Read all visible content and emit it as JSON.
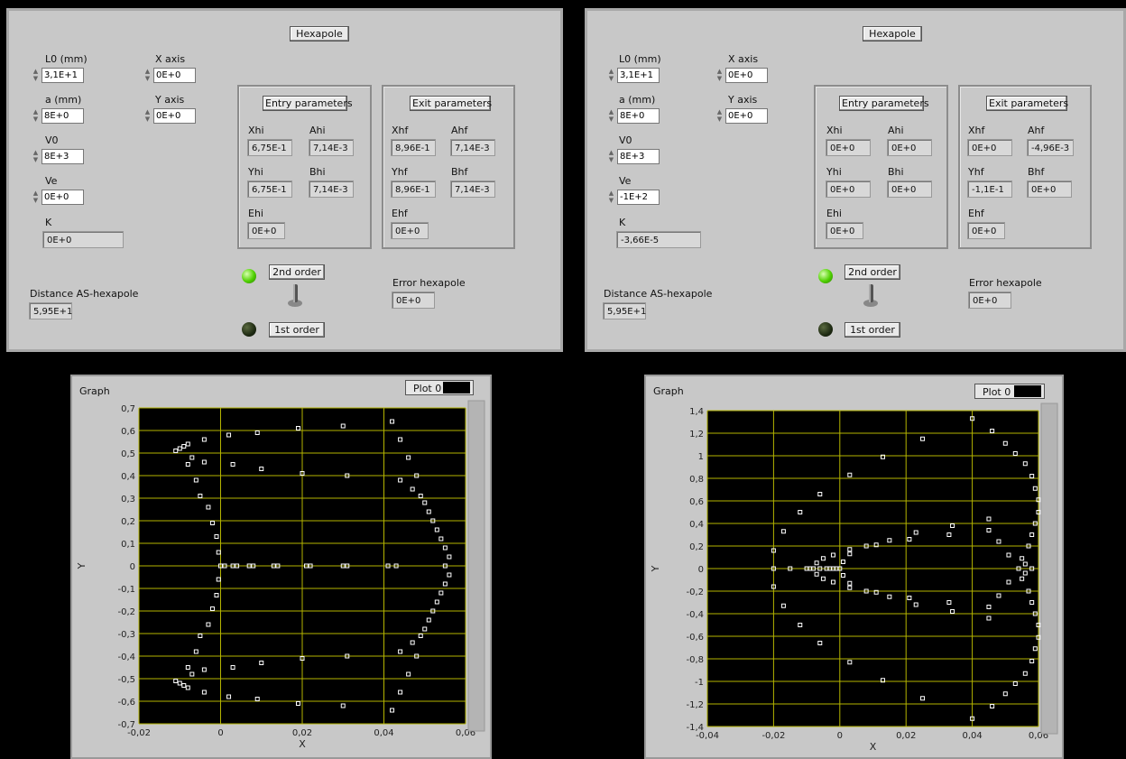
{
  "panels": [
    {
      "title": "Hexapole",
      "L0": {
        "label": "L0 (mm)",
        "value": "3,1E+1"
      },
      "a": {
        "label": "a (mm)",
        "value": "8E+0"
      },
      "V0": {
        "label": "V0",
        "value": "8E+3"
      },
      "Ve": {
        "label": "Ve",
        "value": "0E+0"
      },
      "K": {
        "label": "K",
        "value": "0E+0"
      },
      "xaxis": {
        "label": "X axis",
        "value": "0E+0"
      },
      "yaxis": {
        "label": "Y axis",
        "value": "0E+0"
      },
      "entry": {
        "title": "Entry parameters",
        "Xhi": {
          "label": "Xhi",
          "value": "6,75E-1"
        },
        "Ahi": {
          "label": "Ahi",
          "value": "7,14E-3"
        },
        "Yhi": {
          "label": "Yhi",
          "value": "6,75E-1"
        },
        "Bhi": {
          "label": "Bhi",
          "value": "7,14E-3"
        },
        "Ehi": {
          "label": "Ehi",
          "value": "0E+0"
        }
      },
      "exit": {
        "title": "Exit parameters",
        "Xhf": {
          "label": "Xhf",
          "value": "8,96E-1"
        },
        "Ahf": {
          "label": "Ahf",
          "value": "7,14E-3"
        },
        "Yhf": {
          "label": "Yhf",
          "value": "8,96E-1"
        },
        "Bhf": {
          "label": "Bhf",
          "value": "7,14E-3"
        },
        "Ehf": {
          "label": "Ehf",
          "value": "0E+0"
        }
      },
      "distance": {
        "label": "Distance AS-hexapole",
        "value": "5,95E+1"
      },
      "second_order": "2nd order",
      "first_order": "1st order",
      "error": {
        "label": "Error hexapole",
        "value": "0E+0"
      }
    },
    {
      "title": "Hexapole",
      "L0": {
        "label": "L0 (mm)",
        "value": "3,1E+1"
      },
      "a": {
        "label": "a (mm)",
        "value": "8E+0"
      },
      "V0": {
        "label": "V0",
        "value": "8E+3"
      },
      "Ve": {
        "label": "Ve",
        "value": "-1E+2"
      },
      "K": {
        "label": "K",
        "value": "-3,66E-5"
      },
      "xaxis": {
        "label": "X axis",
        "value": "0E+0"
      },
      "yaxis": {
        "label": "Y axis",
        "value": "0E+0"
      },
      "entry": {
        "title": "Entry parameters",
        "Xhi": {
          "label": "Xhi",
          "value": "0E+0"
        },
        "Ahi": {
          "label": "Ahi",
          "value": "0E+0"
        },
        "Yhi": {
          "label": "Yhi",
          "value": "0E+0"
        },
        "Bhi": {
          "label": "Bhi",
          "value": "0E+0"
        },
        "Ehi": {
          "label": "Ehi",
          "value": "0E+0"
        }
      },
      "exit": {
        "title": "Exit parameters",
        "Xhf": {
          "label": "Xhf",
          "value": "0E+0"
        },
        "Ahf": {
          "label": "Ahf",
          "value": "-4,96E-3"
        },
        "Yhf": {
          "label": "Yhf",
          "value": "-1,1E-1"
        },
        "Bhf": {
          "label": "Bhf",
          "value": "0E+0"
        },
        "Ehf": {
          "label": "Ehf",
          "value": "0E+0"
        }
      },
      "distance": {
        "label": "Distance AS-hexapole",
        "value": "5,95E+1"
      },
      "second_order": "2nd order",
      "first_order": "1st order",
      "error": {
        "label": "Error hexapole",
        "value": "0E+0"
      }
    }
  ],
  "graphs": [
    {
      "title": "Graph",
      "legend": "Plot 0",
      "xlabel": "X",
      "ylabel": "Y",
      "xticks": [
        "-0,02",
        "0",
        "0,02",
        "0,04",
        "0,06"
      ],
      "yticks": [
        "0,7",
        "0,6",
        "0,5",
        "0,4",
        "0,3",
        "0,2",
        "0,1",
        "0",
        "-0,1",
        "-0,2",
        "-0,3",
        "-0,4",
        "-0,5",
        "-0,6",
        "-0,7"
      ]
    },
    {
      "title": "Graph",
      "legend": "Plot 0",
      "xlabel": "X",
      "ylabel": "Y",
      "xticks": [
        "-0,04",
        "-0,02",
        "0",
        "0,02",
        "0,04",
        "0,06"
      ],
      "yticks": [
        "1,4",
        "1,2",
        "1",
        "0,8",
        "0,6",
        "0,4",
        "0,2",
        "0",
        "-0,2",
        "-0,4",
        "-0,6",
        "-0,8",
        "-1",
        "-1,2",
        "-1,4"
      ]
    }
  ],
  "colors": {
    "plot_bg": "#000000",
    "grid": "#b4b400",
    "points": "#ffffff",
    "led_on": "#4fd000",
    "led_off": "#1e2a12"
  },
  "chart_data": [
    {
      "type": "scatter",
      "title": "Graph",
      "xlabel": "X",
      "ylabel": "Y",
      "xlim": [
        -0.02,
        0.06
      ],
      "ylim": [
        -0.7,
        0.7
      ],
      "grid": true,
      "legend": "top-right",
      "series": [
        {
          "name": "Plot 0",
          "points": [
            [
              -0.011,
              0.51
            ],
            [
              -0.01,
              0.52
            ],
            [
              -0.009,
              0.53
            ],
            [
              -0.008,
              0.45
            ],
            [
              -0.008,
              0.54
            ],
            [
              -0.007,
              0.48
            ],
            [
              -0.006,
              0.38
            ],
            [
              -0.005,
              0.31
            ],
            [
              -0.004,
              0.56
            ],
            [
              -0.004,
              0.46
            ],
            [
              -0.003,
              0.26
            ],
            [
              -0.002,
              0.19
            ],
            [
              -0.001,
              0.13
            ],
            [
              -0.0005,
              0.06
            ],
            [
              0,
              0
            ],
            [
              0.002,
              0.58
            ],
            [
              0.003,
              0.45
            ],
            [
              0.009,
              0.59
            ],
            [
              0.01,
              0.43
            ],
            [
              0.019,
              0.61
            ],
            [
              0.02,
              0.41
            ],
            [
              0.03,
              0.62
            ],
            [
              0.031,
              0.4
            ],
            [
              0.042,
              0.64
            ],
            [
              0.044,
              0.56
            ],
            [
              0.044,
              0.38
            ],
            [
              0.046,
              0.48
            ],
            [
              0.047,
              0.34
            ],
            [
              0.048,
              0.4
            ],
            [
              0.049,
              0.31
            ],
            [
              0.05,
              0.28
            ],
            [
              0.051,
              0.24
            ],
            [
              0.052,
              0.2
            ],
            [
              0.053,
              0.16
            ],
            [
              0.054,
              0.12
            ],
            [
              0.055,
              0.08
            ],
            [
              0.056,
              0.04
            ],
            [
              0.055,
              0.0
            ],
            [
              0.056,
              -0.04
            ],
            [
              0.055,
              -0.08
            ],
            [
              0.054,
              -0.12
            ],
            [
              0.053,
              -0.16
            ],
            [
              0.052,
              -0.2
            ],
            [
              0.051,
              -0.24
            ],
            [
              0.05,
              -0.28
            ],
            [
              0.049,
              -0.31
            ],
            [
              0.048,
              -0.4
            ],
            [
              0.047,
              -0.34
            ],
            [
              0.046,
              -0.48
            ],
            [
              0.044,
              -0.56
            ],
            [
              0.044,
              -0.38
            ],
            [
              0.042,
              -0.64
            ],
            [
              0.031,
              -0.4
            ],
            [
              0.03,
              -0.62
            ],
            [
              0.02,
              -0.41
            ],
            [
              0.019,
              -0.61
            ],
            [
              0.01,
              -0.43
            ],
            [
              0.009,
              -0.59
            ],
            [
              0.003,
              -0.45
            ],
            [
              0.002,
              -0.58
            ],
            [
              -0.0005,
              -0.06
            ],
            [
              -0.001,
              -0.13
            ],
            [
              -0.002,
              -0.19
            ],
            [
              -0.003,
              -0.26
            ],
            [
              -0.004,
              -0.46
            ],
            [
              -0.004,
              -0.56
            ],
            [
              -0.005,
              -0.31
            ],
            [
              -0.006,
              -0.38
            ],
            [
              -0.007,
              -0.48
            ],
            [
              -0.008,
              -0.54
            ],
            [
              -0.008,
              -0.45
            ],
            [
              -0.009,
              -0.53
            ],
            [
              -0.01,
              -0.52
            ],
            [
              -0.011,
              -0.51
            ],
            [
              0.001,
              0
            ],
            [
              0.003,
              0
            ],
            [
              0.004,
              0
            ],
            [
              0.007,
              0
            ],
            [
              0.008,
              0
            ],
            [
              0.013,
              0
            ],
            [
              0.014,
              0
            ],
            [
              0.021,
              0
            ],
            [
              0.022,
              0
            ],
            [
              0.03,
              0
            ],
            [
              0.031,
              0
            ],
            [
              0.041,
              0
            ],
            [
              0.043,
              0
            ]
          ]
        }
      ]
    },
    {
      "type": "scatter",
      "title": "Graph",
      "xlabel": "X",
      "ylabel": "Y",
      "xlim": [
        -0.04,
        0.06
      ],
      "ylim": [
        -1.4,
        1.4
      ],
      "grid": true,
      "legend": "top-right",
      "series": [
        {
          "name": "Plot 0",
          "points": [
            [
              -0.02,
              0
            ],
            [
              -0.02,
              0.16
            ],
            [
              -0.02,
              -0.16
            ],
            [
              -0.017,
              0.33
            ],
            [
              -0.017,
              -0.33
            ],
            [
              -0.015,
              0
            ],
            [
              -0.012,
              0.5
            ],
            [
              -0.012,
              -0.5
            ],
            [
              -0.01,
              0
            ],
            [
              -0.009,
              0
            ],
            [
              -0.008,
              0
            ],
            [
              -0.007,
              0.05
            ],
            [
              -0.007,
              -0.05
            ],
            [
              -0.006,
              0
            ],
            [
              -0.005,
              0.09
            ],
            [
              -0.005,
              -0.09
            ],
            [
              -0.006,
              0.66
            ],
            [
              -0.006,
              -0.66
            ],
            [
              -0.004,
              0
            ],
            [
              -0.003,
              0
            ],
            [
              -0.002,
              0
            ],
            [
              -0.001,
              0
            ],
            [
              0,
              0
            ],
            [
              -0.002,
              0.12
            ],
            [
              -0.002,
              -0.12
            ],
            [
              0.001,
              0.06
            ],
            [
              0.001,
              -0.06
            ],
            [
              0.003,
              0.17
            ],
            [
              0.003,
              -0.17
            ],
            [
              0.003,
              0.13
            ],
            [
              0.003,
              -0.13
            ],
            [
              0.003,
              0.83
            ],
            [
              0.003,
              -0.83
            ],
            [
              0.008,
              0.2
            ],
            [
              0.008,
              -0.2
            ],
            [
              0.011,
              0.21
            ],
            [
              0.011,
              -0.21
            ],
            [
              0.013,
              0.99
            ],
            [
              0.013,
              -0.99
            ],
            [
              0.015,
              0.25
            ],
            [
              0.015,
              -0.25
            ],
            [
              0.021,
              0.26
            ],
            [
              0.021,
              -0.26
            ],
            [
              0.023,
              0.32
            ],
            [
              0.023,
              -0.32
            ],
            [
              0.025,
              1.15
            ],
            [
              0.025,
              -1.15
            ],
            [
              0.033,
              0.3
            ],
            [
              0.033,
              -0.3
            ],
            [
              0.034,
              0.38
            ],
            [
              0.034,
              -0.38
            ],
            [
              0.04,
              1.33
            ],
            [
              0.04,
              -1.33
            ],
            [
              0.045,
              0.44
            ],
            [
              0.045,
              -0.44
            ],
            [
              0.046,
              1.22
            ],
            [
              0.046,
              -1.22
            ],
            [
              0.045,
              0.34
            ],
            [
              0.045,
              -0.34
            ],
            [
              0.048,
              0.24
            ],
            [
              0.048,
              -0.24
            ],
            [
              0.05,
              1.11
            ],
            [
              0.05,
              -1.11
            ],
            [
              0.051,
              0.12
            ],
            [
              0.051,
              -0.12
            ],
            [
              0.053,
              1.02
            ],
            [
              0.053,
              -1.02
            ],
            [
              0.054,
              0
            ],
            [
              0.055,
              0.09
            ],
            [
              0.055,
              -0.09
            ],
            [
              0.056,
              0.93
            ],
            [
              0.056,
              -0.93
            ],
            [
              0.057,
              0.2
            ],
            [
              0.057,
              -0.2
            ],
            [
              0.058,
              0.82
            ],
            [
              0.058,
              -0.82
            ],
            [
              0.058,
              0.3
            ],
            [
              0.058,
              -0.3
            ],
            [
              0.059,
              0.4
            ],
            [
              0.059,
              -0.4
            ],
            [
              0.059,
              0.71
            ],
            [
              0.059,
              -0.71
            ],
            [
              0.06,
              0.5
            ],
            [
              0.06,
              -0.5
            ],
            [
              0.06,
              0.61
            ],
            [
              0.06,
              -0.61
            ],
            [
              0.058,
              0
            ],
            [
              0.056,
              0.04
            ],
            [
              0.056,
              -0.04
            ]
          ]
        }
      ]
    }
  ]
}
